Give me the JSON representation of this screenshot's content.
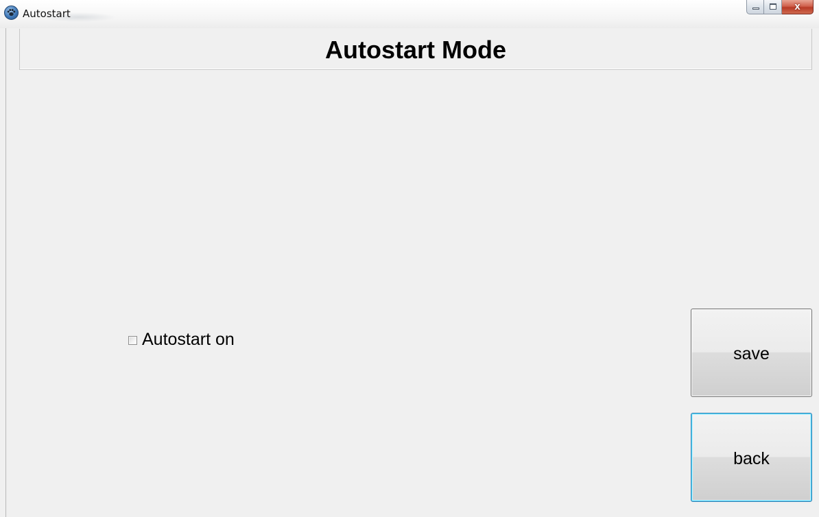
{
  "window": {
    "title": "Autostart",
    "icon": "paw-icon",
    "controls": {
      "minimize": "minimize-icon",
      "maximize": "maximize-icon",
      "close_glyph": "x"
    }
  },
  "header": {
    "title": "Autostart Mode"
  },
  "form": {
    "autostart_checkbox": {
      "label": "Autostart on",
      "checked": false
    }
  },
  "actions": {
    "save_label": "save",
    "back_label": "back",
    "focused": "back"
  },
  "colors": {
    "window_bg": "#f0f0f0",
    "close_button": "#c9462f",
    "focus_border": "#3c7fb1"
  }
}
